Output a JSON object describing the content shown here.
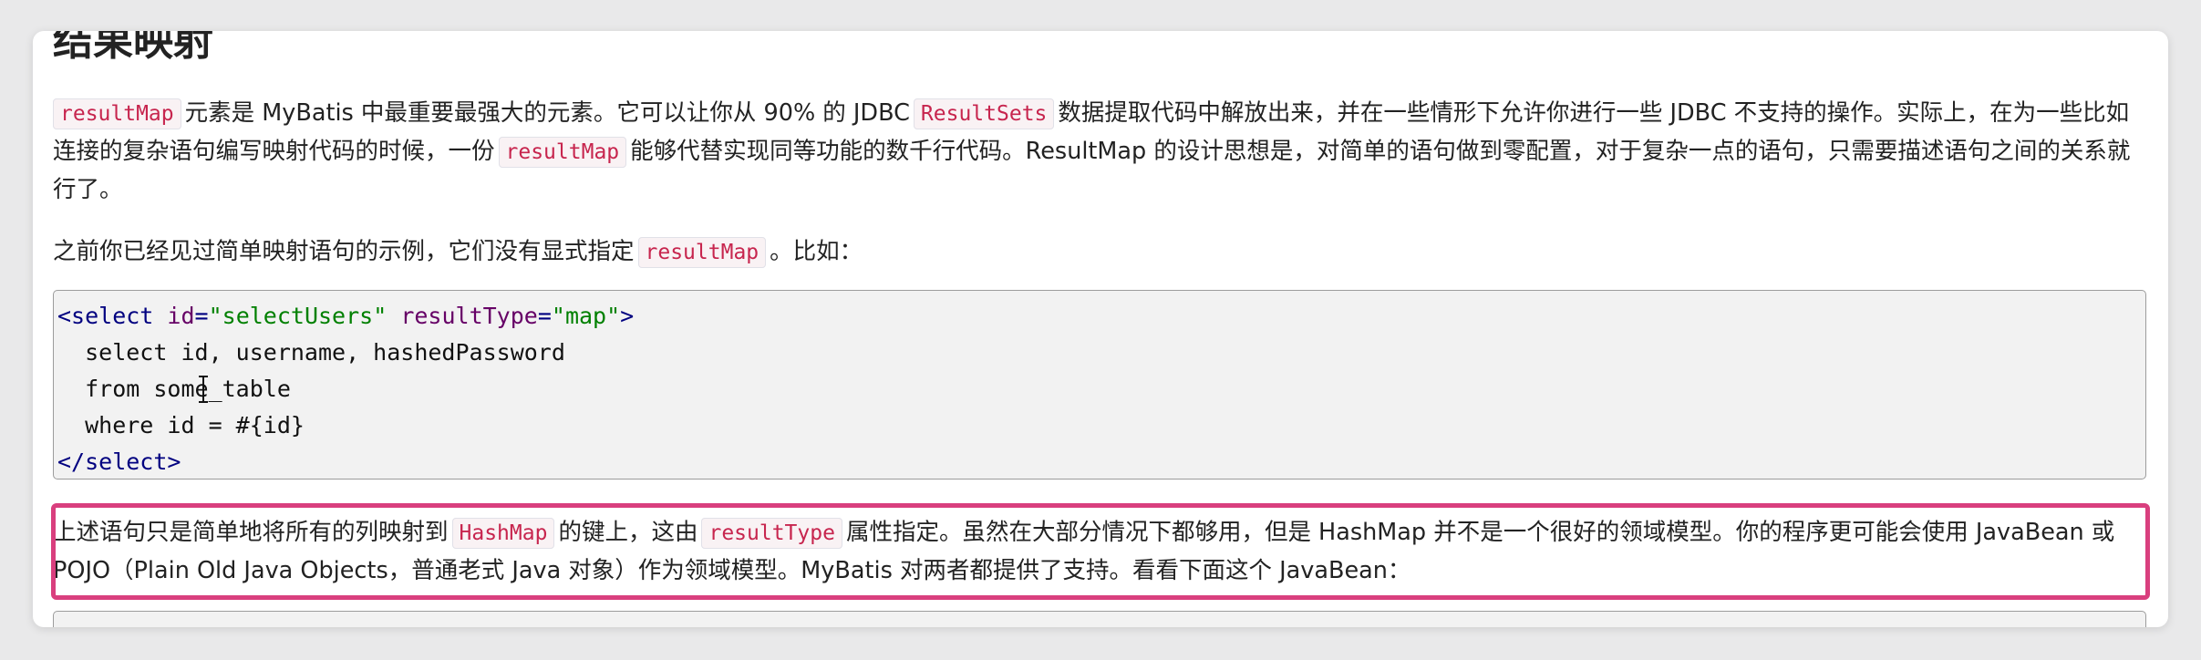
{
  "heading": "结果映射",
  "para1": {
    "code1": "resultMap",
    "t1": "元素是 MyBatis 中最重要最强大的元素。它可以让你从 90% 的 JDBC",
    "code2": "ResultSets",
    "t2": "数据提取代码中解放出来，并在一些情形下允许你进行一些 JDBC 不支持的操作。实际上，在为一些比如连接的复杂语句编写映射代码的时候，一份",
    "code3": "resultMap",
    "t3": "能够代替实现同等功能的数千行代码。ResultMap 的设计思想是，对简单的语句做到零配置，对于复杂一点的语句，只需要描述语句之间的关系就行了。"
  },
  "para2": {
    "t1": "之前你已经见过简单映射语句的示例，它们没有显式指定",
    "code1": "resultMap",
    "t2": "。比如："
  },
  "code": {
    "l1_open": "<select",
    "l1_attr1": "id",
    "l1_eq1": "=",
    "l1_val1": "\"selectUsers\"",
    "l1_attr2": "resultType",
    "l1_eq2": "=",
    "l1_val2": "\"map\"",
    "l1_close": ">",
    "l2": "  select id, username, hashedPassword",
    "l3": "  from some_table",
    "l4": "  where id = #{id}",
    "l5": "</select>"
  },
  "para3": {
    "t1": "上述语句只是简单地将所有的列映射到",
    "code1": "HashMap",
    "t2": "的键上，这由",
    "code2": "resultType",
    "t3": "属性指定。虽然在大部分情况下都够用，但是 HashMap 并不是一个很好的领域模型。你的程序更可能会使用 JavaBean 或 POJO（Plain Old Java Objects，普通老式 Java 对象）作为领域模型。MyBatis 对两者都提供了支持。看看下面这个 JavaBean："
  },
  "colors": {
    "highlight": "#d93f7e",
    "inline_code": "#c7254e"
  }
}
